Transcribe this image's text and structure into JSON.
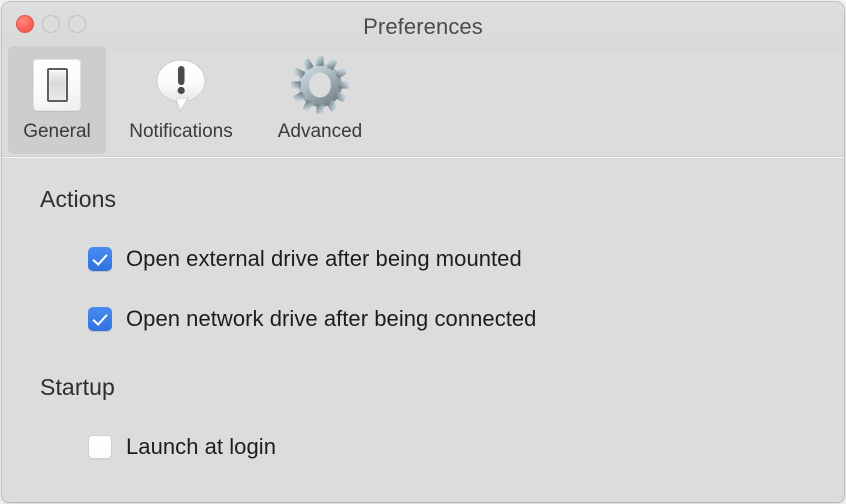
{
  "window": {
    "title": "Preferences",
    "traffic_lights": [
      {
        "name": "close",
        "color": "#fc6056"
      },
      {
        "name": "minimize",
        "color": "#dcdcdc"
      },
      {
        "name": "zoom",
        "color": "#dcdcdc"
      }
    ]
  },
  "toolbar": {
    "tabs": [
      {
        "label": "General",
        "icon": "light-switch-icon",
        "selected": true
      },
      {
        "label": "Notifications",
        "icon": "speech-bubble-exclamation-icon",
        "selected": false
      },
      {
        "label": "Advanced",
        "icon": "gear-icon",
        "selected": false
      }
    ]
  },
  "content": {
    "sections": [
      {
        "title": "Actions",
        "options": [
          {
            "label": "Open external drive after being mounted",
            "checked": true
          },
          {
            "label": "Open network drive after being connected",
            "checked": true
          }
        ]
      },
      {
        "title": "Startup",
        "options": [
          {
            "label": "Launch at login",
            "checked": false
          }
        ]
      }
    ]
  },
  "colors": {
    "window_background": "#dcdcdc",
    "titlebar": "#dbdbdb",
    "accent_checkbox": "#2f72df",
    "selected_tab_background": "#cdcdcd",
    "text_primary": "#1d1d1d",
    "text_title": "#4b4b4b"
  }
}
